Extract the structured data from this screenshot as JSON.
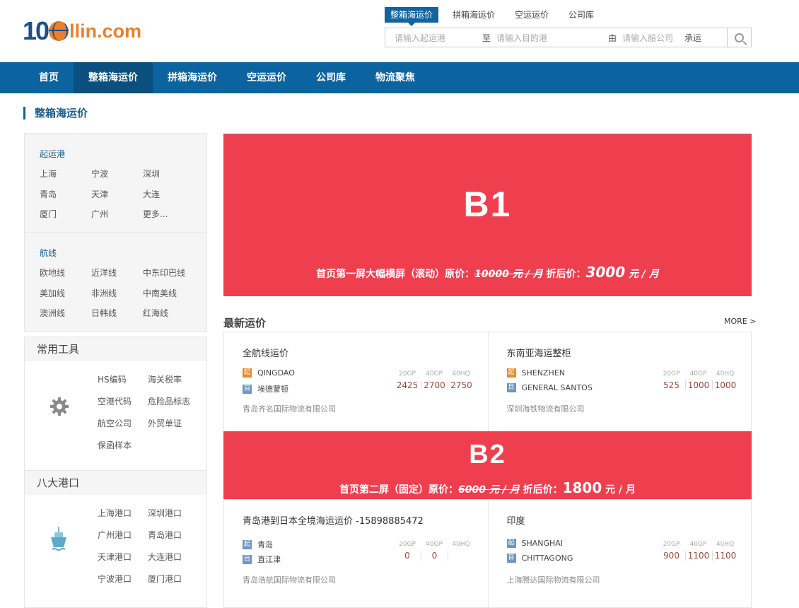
{
  "header": {
    "logo_one": "1",
    "logo_rest": "llin.com",
    "top_tabs": [
      "整箱海运价",
      "拼箱海运价",
      "空运运价",
      "公司库"
    ],
    "search": {
      "origin_placeholder": "请输入起运港",
      "to_label": "至",
      "dest_placeholder": "请输入目的港",
      "by_label": "由",
      "company_placeholder": "请输入船公司",
      "carrier_label": "承运"
    }
  },
  "nav": [
    "首页",
    "整箱海运价",
    "拼箱海运价",
    "空运运价",
    "公司库",
    "物流聚焦"
  ],
  "page_title": "整箱海运价",
  "sidebar": {
    "ports": {
      "title": "起运港",
      "items": [
        "上海",
        "宁波",
        "深圳",
        "青岛",
        "天津",
        "大连",
        "厦门",
        "广州",
        "更多..."
      ]
    },
    "routes": {
      "title": "航线",
      "items": [
        "欧地线",
        "近洋线",
        "中东印巴线",
        "美加线",
        "非洲线",
        "中南美线",
        "澳洲线",
        "日韩线",
        "红海线"
      ]
    },
    "tools": {
      "title": "常用工具",
      "items": [
        "HS编码",
        "海关税率",
        "空港代码",
        "危险品标志",
        "航空公司",
        "外贸单证",
        "保函样本"
      ]
    },
    "big_ports": {
      "title": "八大港口",
      "items": [
        "上海港口",
        "深圳港口",
        "广州港口",
        "青岛港口",
        "天津港口",
        "大连港口",
        "宁波港口",
        "厦门港口"
      ]
    }
  },
  "banner1": {
    "label": "B1",
    "text": "首页第一屏大幅横屏（滚动）原价：",
    "orig_price": "10000 元 / 月",
    "mid": " 折后价：",
    "price": "3000",
    "unit": " 元 / 月"
  },
  "banner2": {
    "label": "B2",
    "text": "首页第二屏（固定）原价：",
    "orig_price": "6000 元 / 月",
    "mid": " 折后价：",
    "price": "1800",
    "unit": " 元 / 月"
  },
  "rates": {
    "title": "最新运价",
    "more": "MORE >",
    "origin_tag": "起",
    "dest_tag": "目",
    "sizes": [
      "20GP",
      "40GP",
      "40HQ"
    ],
    "cards": [
      {
        "title": "全航线运价",
        "origin": "QINGDAO",
        "dest": "埃德蒙顿",
        "prices": [
          "2425",
          "2700",
          "2750"
        ],
        "company": "青岛齐名国际物流有限公司"
      },
      {
        "title": "东南亚海运整柜",
        "origin": "SHENZHEN",
        "dest": "GENERAL SANTOS",
        "prices": [
          "525",
          "1000",
          "1000"
        ],
        "company": "深圳海铁物流有限公司"
      },
      {
        "title": "青岛港到日本全境海运运价 -15898885472",
        "origin": "青岛",
        "dest": "直江津",
        "prices": [
          "0",
          "0",
          ""
        ],
        "company": "青岛浩航国际物流有限公司"
      },
      {
        "title": "印度",
        "origin": "SHANGHAI",
        "dest": "CHITTAGONG",
        "prices": [
          "900",
          "1100",
          "1100"
        ],
        "company": "上海腾达国际物流有限公司"
      }
    ]
  }
}
